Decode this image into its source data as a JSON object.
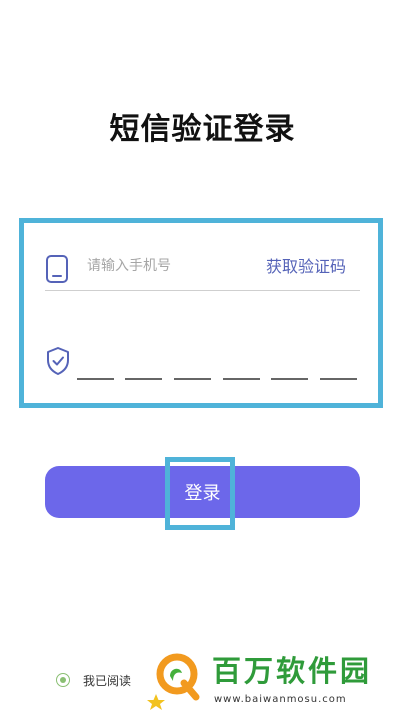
{
  "page": {
    "title": "短信验证登录"
  },
  "phone": {
    "placeholder": "请输入手机号",
    "get_code_label": "获取验证码",
    "icon": "phone-icon"
  },
  "code": {
    "icon": "shield-check-icon",
    "slot_count": 6
  },
  "login": {
    "label": "登录"
  },
  "agreement": {
    "text": "我已阅读"
  },
  "watermark": {
    "name": "百万软件园",
    "url": "www.baiwanmosu.com"
  },
  "colors": {
    "accent": "#6c67ea",
    "link": "#5563b8",
    "highlight": "#4fb3d9",
    "watermark": "#2f9b3a"
  }
}
